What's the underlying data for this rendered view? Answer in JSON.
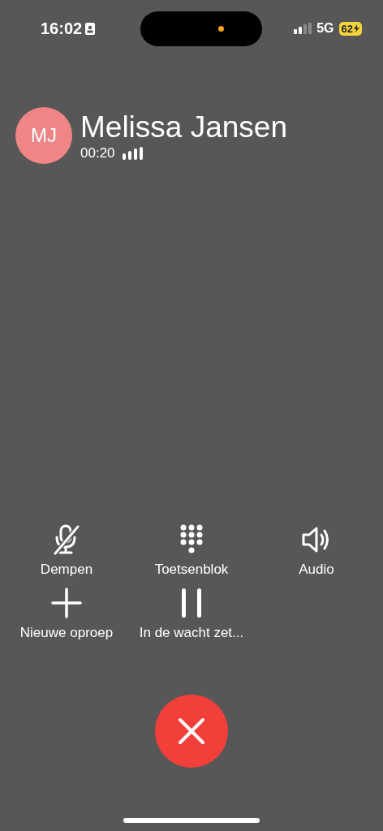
{
  "status_bar": {
    "time": "16:02",
    "network": "5G",
    "battery": "62"
  },
  "caller": {
    "initials": "MJ",
    "name": "Melissa Jansen",
    "duration": "00:20"
  },
  "controls": [
    {
      "kind": "mute",
      "label": "Dempen"
    },
    {
      "kind": "keypad",
      "label": "Toetsenblok"
    },
    {
      "kind": "audio",
      "label": "Audio"
    },
    {
      "kind": "add",
      "label": "Nieuwe oproep"
    },
    {
      "kind": "hold",
      "label": "In de wacht zet..."
    }
  ]
}
